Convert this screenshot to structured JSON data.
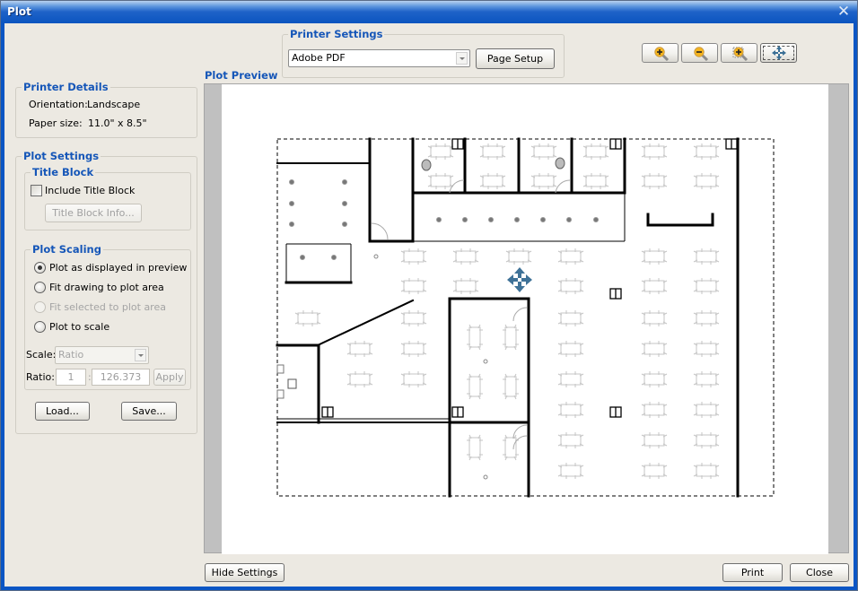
{
  "window": {
    "title": "Plot",
    "close_icon": "close-icon"
  },
  "printer_settings": {
    "legend": "Printer Settings",
    "printer_selected": "Adobe PDF",
    "page_setup_label": "Page Setup"
  },
  "toolbar": {
    "buttons": [
      {
        "name": "zoom-in",
        "icon": "zoom-in-icon"
      },
      {
        "name": "zoom-out",
        "icon": "zoom-out-icon"
      },
      {
        "name": "zoom-window",
        "icon": "zoom-window-icon"
      },
      {
        "name": "pan",
        "icon": "pan-icon",
        "active": true
      }
    ]
  },
  "printer_details": {
    "legend": "Printer Details",
    "orientation_label": "Orientation:",
    "orientation_value": "Landscape",
    "paper_size_label": "Paper size:",
    "paper_size_value": "11.0\" x 8.5\""
  },
  "plot_settings": {
    "legend": "Plot Settings",
    "title_block": {
      "legend": "Title Block",
      "include_label": "Include Title Block",
      "include_checked": false,
      "info_button": "Title Block Info..."
    },
    "plot_scaling": {
      "legend": "Plot Scaling",
      "options": [
        {
          "label": "Plot as displayed in preview",
          "checked": true,
          "enabled": true
        },
        {
          "label": "Fit drawing to plot area",
          "checked": false,
          "enabled": true
        },
        {
          "label": "Fit selected to plot area",
          "checked": false,
          "enabled": false
        },
        {
          "label": "Plot to scale",
          "checked": false,
          "enabled": true
        }
      ],
      "scale_label": "Scale:",
      "scale_value": "Ratio",
      "ratio_label": "Ratio:",
      "ratio_left": "1",
      "ratio_sep": ":",
      "ratio_right": "126.373",
      "apply_label": "Apply"
    },
    "load_label": "Load...",
    "save_label": "Save..."
  },
  "preview": {
    "label": "Plot Preview",
    "cursor_icon": "move-cursor-icon"
  },
  "footer": {
    "hide_settings_label": "Hide Settings",
    "print_label": "Print",
    "close_label": "Close"
  }
}
